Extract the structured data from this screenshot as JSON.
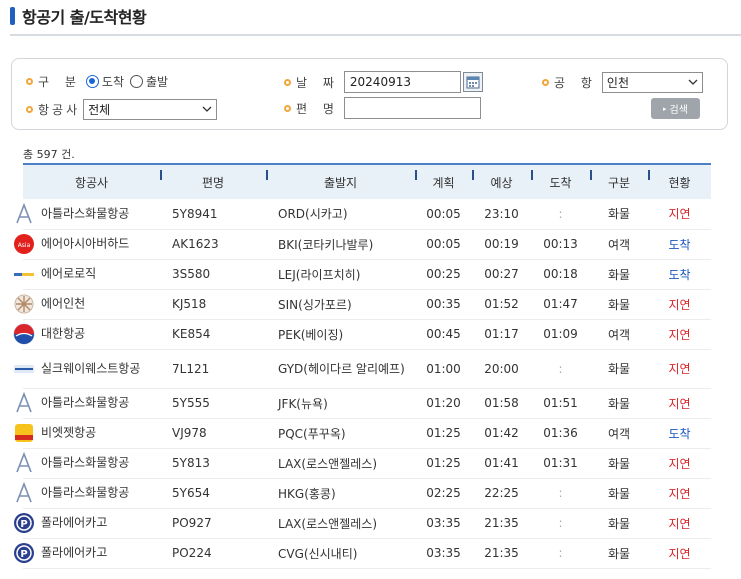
{
  "page": {
    "title": "항공기 출/도착현황"
  },
  "search": {
    "type_label": "구 분",
    "type_options": [
      "도착",
      "출발"
    ],
    "type_selected": "도착",
    "date_label": "날 짜",
    "date_value": "20240913",
    "airport_label": "공 항",
    "airport_value": "인천",
    "airline_label": "항공사",
    "airline_value": "전체",
    "flight_label": "편 명",
    "flight_value": "",
    "search_button": "검색"
  },
  "total": "총 597 건.",
  "table": {
    "headers": [
      "항공사",
      "편명",
      "출발지",
      "계획",
      "예상",
      "도착",
      "구분",
      "현황"
    ],
    "rows": [
      {
        "airline": "아틀라스화물항공",
        "logo": "atlas-logo",
        "flight": "5Y8941",
        "origin": "ORD(시카고)",
        "plan": "00:05",
        "expected": "23:10",
        "arrived": ":",
        "kind": "화물",
        "status": "지연"
      },
      {
        "airline": "에어아시아버하드",
        "logo": "airasia-logo",
        "flight": "AK1623",
        "origin": "BKI(코타키나발루)",
        "plan": "00:05",
        "expected": "00:19",
        "arrived": "00:13",
        "kind": "여객",
        "status": "도착"
      },
      {
        "airline": "에어로로직",
        "logo": "aerologic-logo",
        "flight": "3S580",
        "origin": "LEJ(라이프치히)",
        "plan": "00:25",
        "expected": "00:27",
        "arrived": "00:18",
        "kind": "화물",
        "status": "도착"
      },
      {
        "airline": "에어인천",
        "logo": "airincheon-logo",
        "flight": "KJ518",
        "origin": "SIN(싱가포르)",
        "plan": "00:35",
        "expected": "01:52",
        "arrived": "01:47",
        "kind": "화물",
        "status": "지연"
      },
      {
        "airline": "대한항공",
        "logo": "koreanair-logo",
        "flight": "KE854",
        "origin": "PEK(베이징)",
        "plan": "00:45",
        "expected": "01:17",
        "arrived": "01:09",
        "kind": "여객",
        "status": "지연"
      },
      {
        "airline": "실크웨이웨스트항공",
        "logo": "silkway-logo",
        "flight": "7L121",
        "origin": "GYD(헤이다르 알리예프)",
        "plan": "01:00",
        "expected": "20:00",
        "arrived": ":",
        "kind": "화물",
        "status": "지연"
      },
      {
        "airline": "아틀라스화물항공",
        "logo": "atlas-logo",
        "flight": "5Y555",
        "origin": "JFK(뉴욕)",
        "plan": "01:20",
        "expected": "01:58",
        "arrived": "01:51",
        "kind": "화물",
        "status": "지연"
      },
      {
        "airline": "비엣젯항공",
        "logo": "vietjet-logo",
        "flight": "VJ978",
        "origin": "PQC(푸꾸옥)",
        "plan": "01:25",
        "expected": "01:42",
        "arrived": "01:36",
        "kind": "여객",
        "status": "도착"
      },
      {
        "airline": "아틀라스화물항공",
        "logo": "atlas-logo",
        "flight": "5Y813",
        "origin": "LAX(로스앤젤레스)",
        "plan": "01:25",
        "expected": "01:41",
        "arrived": "01:31",
        "kind": "화물",
        "status": "지연"
      },
      {
        "airline": "아틀라스화물항공",
        "logo": "atlas-logo",
        "flight": "5Y654",
        "origin": "HKG(홍콩)",
        "plan": "02:25",
        "expected": "22:25",
        "arrived": ":",
        "kind": "화물",
        "status": "지연"
      },
      {
        "airline": "폴라에어카고",
        "logo": "polar-logo",
        "flight": "PO927",
        "origin": "LAX(로스앤젤레스)",
        "plan": "03:35",
        "expected": "21:35",
        "arrived": ":",
        "kind": "화물",
        "status": "지연"
      },
      {
        "airline": "폴라에어카고",
        "logo": "polar-logo",
        "flight": "PO224",
        "origin": "CVG(신시내티)",
        "plan": "03:35",
        "expected": "21:35",
        "arrived": ":",
        "kind": "화물",
        "status": "지연"
      }
    ]
  },
  "colors": {
    "accent": "#1f5fc2",
    "header_rule": "#4b7fc6",
    "delay": "#d9252a",
    "arrived": "#1b57c0",
    "header_bg": "#e9f1f8"
  }
}
